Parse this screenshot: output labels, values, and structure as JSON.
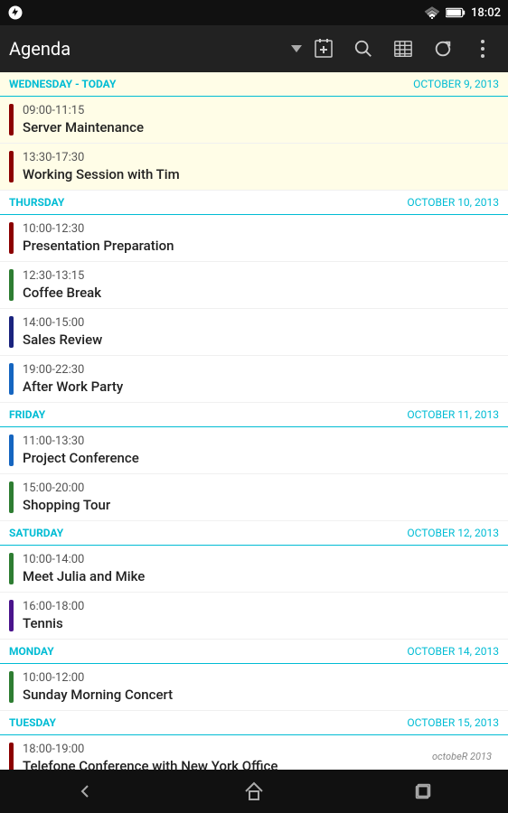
{
  "statusBar": {
    "time": "18:02"
  },
  "toolbar": {
    "title": "Agenda",
    "icons": [
      "new-event-icon",
      "search-icon",
      "calendar-icon",
      "refresh-icon",
      "more-icon"
    ]
  },
  "days": [
    {
      "name": "WEDNESDAY - TODAY",
      "date": "OCTOBER 9, 2013",
      "isToday": true,
      "events": [
        {
          "time": "09:00-11:15",
          "title": "Server Maintenance",
          "color": "#8B0000"
        },
        {
          "time": "13:30-17:30",
          "title": "Working Session with Tim",
          "color": "#8B0000"
        }
      ]
    },
    {
      "name": "THURSDAY",
      "date": "OCTOBER 10, 2013",
      "isToday": false,
      "events": [
        {
          "time": "10:00-12:30",
          "title": "Presentation Preparation",
          "color": "#8B0000"
        },
        {
          "time": "12:30-13:15",
          "title": "Coffee Break",
          "color": "#2e7d32"
        },
        {
          "time": "14:00-15:00",
          "title": "Sales Review",
          "color": "#1a237e"
        },
        {
          "time": "19:00-22:30",
          "title": "After Work Party",
          "color": "#1565c0"
        }
      ]
    },
    {
      "name": "FRIDAY",
      "date": "OCTOBER 11, 2013",
      "isToday": false,
      "events": [
        {
          "time": "11:00-13:30",
          "title": "Project Conference",
          "color": "#1565c0"
        },
        {
          "time": "15:00-20:00",
          "title": "Shopping Tour",
          "color": "#2e7d32"
        }
      ]
    },
    {
      "name": "SATURDAY",
      "date": "OCTOBER 12, 2013",
      "isToday": false,
      "events": [
        {
          "time": "10:00-14:00",
          "title": "Meet Julia and Mike",
          "color": "#2e7d32"
        },
        {
          "time": "16:00-18:00",
          "title": "Tennis",
          "color": "#4a148c"
        }
      ]
    },
    {
      "name": "MONDAY",
      "date": "OCTOBER 14, 2013",
      "isToday": false,
      "events": [
        {
          "time": "10:00-12:00",
          "title": "Sunday Morning Concert",
          "color": "#2e7d32"
        }
      ]
    },
    {
      "name": "TUESDAY",
      "date": "OCTOBER 15, 2013",
      "isToday": false,
      "events": [
        {
          "time": "18:00-19:00",
          "title": "Telefone Conference with New York Office",
          "color": "#8B0000"
        }
      ]
    }
  ],
  "miniCalendarLabel": "octobeR 2013",
  "navBar": {
    "back": "◁",
    "home": "△",
    "recents": "□"
  }
}
